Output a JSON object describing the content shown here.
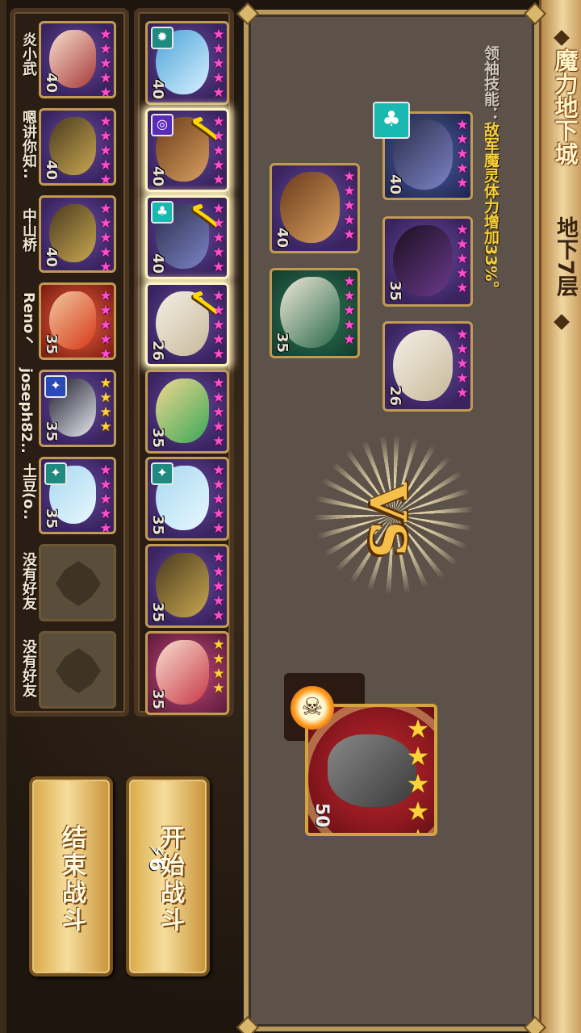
{
  "title": {
    "main": "魔力地下城",
    "floor": "地下7层"
  },
  "hint": {
    "label": "领袖技能：",
    "value": "敌军魔灵体力增加33%。"
  },
  "vs_text": "VS",
  "boss": {
    "level": "50",
    "stars": "★★★★★"
  },
  "enemy_team": [
    {
      "level": "40",
      "stars": "★★★★★",
      "badge": "♣"
    },
    {
      "level": "35",
      "stars": "★★★★★"
    },
    {
      "level": "26",
      "stars": "★★★★★"
    },
    {
      "level": "40",
      "stars": "★★★★★"
    },
    {
      "level": "35",
      "stars": "★★★★★"
    }
  ],
  "my_monsters": [
    {
      "level": "40",
      "stars": "★★★★★",
      "selected": false,
      "badge": "✹"
    },
    {
      "level": "40",
      "stars": "★★★★★",
      "selected": true,
      "badge": "◎"
    },
    {
      "level": "40",
      "stars": "★★★★★",
      "selected": true,
      "badge": "♣"
    },
    {
      "level": "26",
      "stars": "★★★★★",
      "selected": true
    },
    {
      "level": "35",
      "stars": "★★★★★",
      "selected": false
    },
    {
      "level": "35",
      "stars": "★★★★★",
      "selected": false,
      "badge": "✦"
    },
    {
      "level": "35",
      "stars": "★★★★★",
      "selected": false
    },
    {
      "level": "35",
      "stars": "★★★★",
      "selected": false
    }
  ],
  "friends": [
    {
      "name": "炎小武",
      "level": "40",
      "stars": "★★★★★"
    },
    {
      "name": "嗯讲你知..",
      "level": "40",
      "stars": "★★★★★"
    },
    {
      "name": "中山桥",
      "level": "40",
      "stars": "★★★★★"
    },
    {
      "name": "Reno丶",
      "level": "35",
      "stars": "★★★★★"
    },
    {
      "name": "joseph82..",
      "level": "35",
      "stars": "★★★★",
      "badge": "✦"
    },
    {
      "name": "土豆(o..",
      "level": "35",
      "stars": "★★★★★",
      "badge": "✦"
    },
    {
      "name": "没有好友"
    },
    {
      "name": "没有好友"
    }
  ],
  "buttons": {
    "start": "开始战斗",
    "end": "结束战斗",
    "energy": "⚡6"
  },
  "colors": {
    "gold_frame": "#c29b52",
    "panel": "#5c5249",
    "selected_check": "#ffd800",
    "pink_star": "#ff4fd0",
    "gold_star": "#ffd23a"
  }
}
